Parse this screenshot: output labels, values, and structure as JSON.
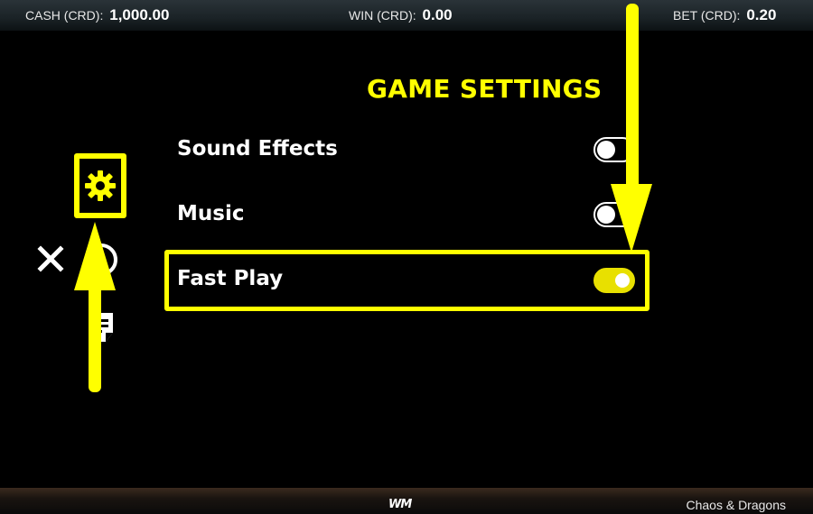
{
  "topbar": {
    "cash": {
      "label": "CASH (CRD):",
      "value": "1,000.00"
    },
    "win": {
      "label": "WIN (CRD):",
      "value": "0.00"
    },
    "bet": {
      "label": "BET (CRD):",
      "value": "0.20"
    }
  },
  "settings": {
    "title": "GAME SETTINGS",
    "items": [
      {
        "label": "Sound Effects",
        "enabled": false
      },
      {
        "label": "Music",
        "enabled": false
      },
      {
        "label": "Fast Play",
        "enabled": true
      }
    ]
  },
  "menu": {
    "icons": [
      "gear-icon",
      "close-icon",
      "circle-icon",
      "document-icon"
    ]
  },
  "footer": {
    "brand": "WM",
    "game_name": "Chaos & Dragons"
  },
  "colors": {
    "accent": "#ffff00",
    "background": "#000000"
  }
}
